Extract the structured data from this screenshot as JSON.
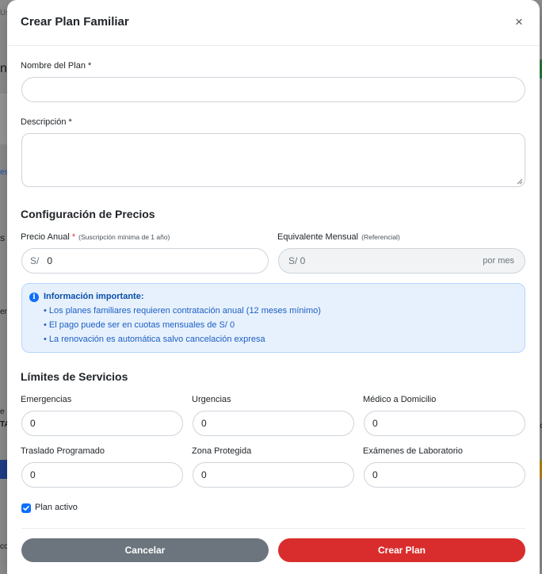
{
  "background": {
    "fragments": [
      "Us",
      "n",
      "es",
      "s (",
      "er",
      "e",
      "TA",
      "ic",
      "co"
    ]
  },
  "modal": {
    "title": "Crear Plan Familiar",
    "close_symbol": "×",
    "fields": {
      "plan_name_label": "Nombre del Plan",
      "required_mark": "*",
      "plan_name_value": "",
      "description_label": "Descripción",
      "description_value": ""
    },
    "pricing": {
      "section_title": "Configuración de Precios",
      "annual_label": "Precio Anual",
      "annual_hint": "(Suscripción mínima de 1 año)",
      "currency_prefix": "S/",
      "annual_value": "0",
      "monthly_label": "Equivalente Mensual",
      "monthly_hint": "(Referencial)",
      "monthly_value": "S/ 0",
      "monthly_suffix": "por mes"
    },
    "info": {
      "icon": "info-icon",
      "title": "Información importante:",
      "items": [
        "• Los planes familiares requieren contratación anual (12 meses mínimo)",
        "• El pago puede ser en cuotas mensuales de S/ 0",
        "• La renovación es automática salvo cancelación expresa"
      ]
    },
    "limits": {
      "section_title": "Límites de Servicios",
      "fields": [
        {
          "label": "Emergencias",
          "value": "0"
        },
        {
          "label": "Urgencias",
          "value": "0"
        },
        {
          "label": "Médico a Domicilio",
          "value": "0"
        },
        {
          "label": "Traslado Programado",
          "value": "0"
        },
        {
          "label": "Zona Protegida",
          "value": "0"
        },
        {
          "label": "Exámenes de Laboratorio",
          "value": "0"
        }
      ]
    },
    "active_label": "Plan activo",
    "active_checked": true,
    "buttons": {
      "cancel": "Cancelar",
      "create": "Crear Plan"
    },
    "colors": {
      "primary": "#0d6efd",
      "danger": "#d92d2d",
      "secondary": "#6c757d",
      "info_bg": "#e7f1fd"
    }
  }
}
